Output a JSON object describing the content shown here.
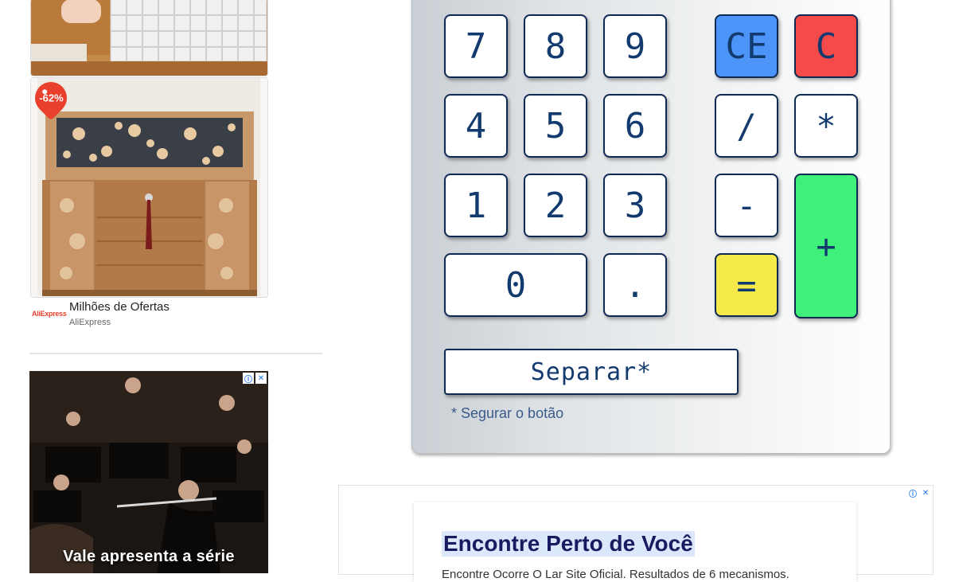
{
  "left_ads": {
    "discount_badge": "-62%",
    "product_ad": {
      "brand_logo": "AliExpress",
      "title": "Milhões de Ofertas",
      "source": "AliExpress"
    },
    "video_ad": {
      "caption": "Vale apresenta a série"
    }
  },
  "calculator": {
    "keys": {
      "k7": "7",
      "k8": "8",
      "k9": "9",
      "ce": "CE",
      "c": "C",
      "k4": "4",
      "k5": "5",
      "k6": "6",
      "divide": "/",
      "multiply": "*",
      "k1": "1",
      "k2": "2",
      "k3": "3",
      "minus": "-",
      "plus": "+",
      "k0": "0",
      "dot": ".",
      "equals": "="
    },
    "separate_button": "Separar*",
    "hint": "* Segurar o botão",
    "colors": {
      "ce": "#4d94f8",
      "c": "#f44a4a",
      "equals": "#f5ea4a",
      "plus": "#3ff07a"
    }
  },
  "bottom_ad": {
    "title": "Encontre Perto de Você",
    "subtitle": "Encontre Ocorre O Lar Site Oficial. Resultados de 6 mecanismos."
  }
}
